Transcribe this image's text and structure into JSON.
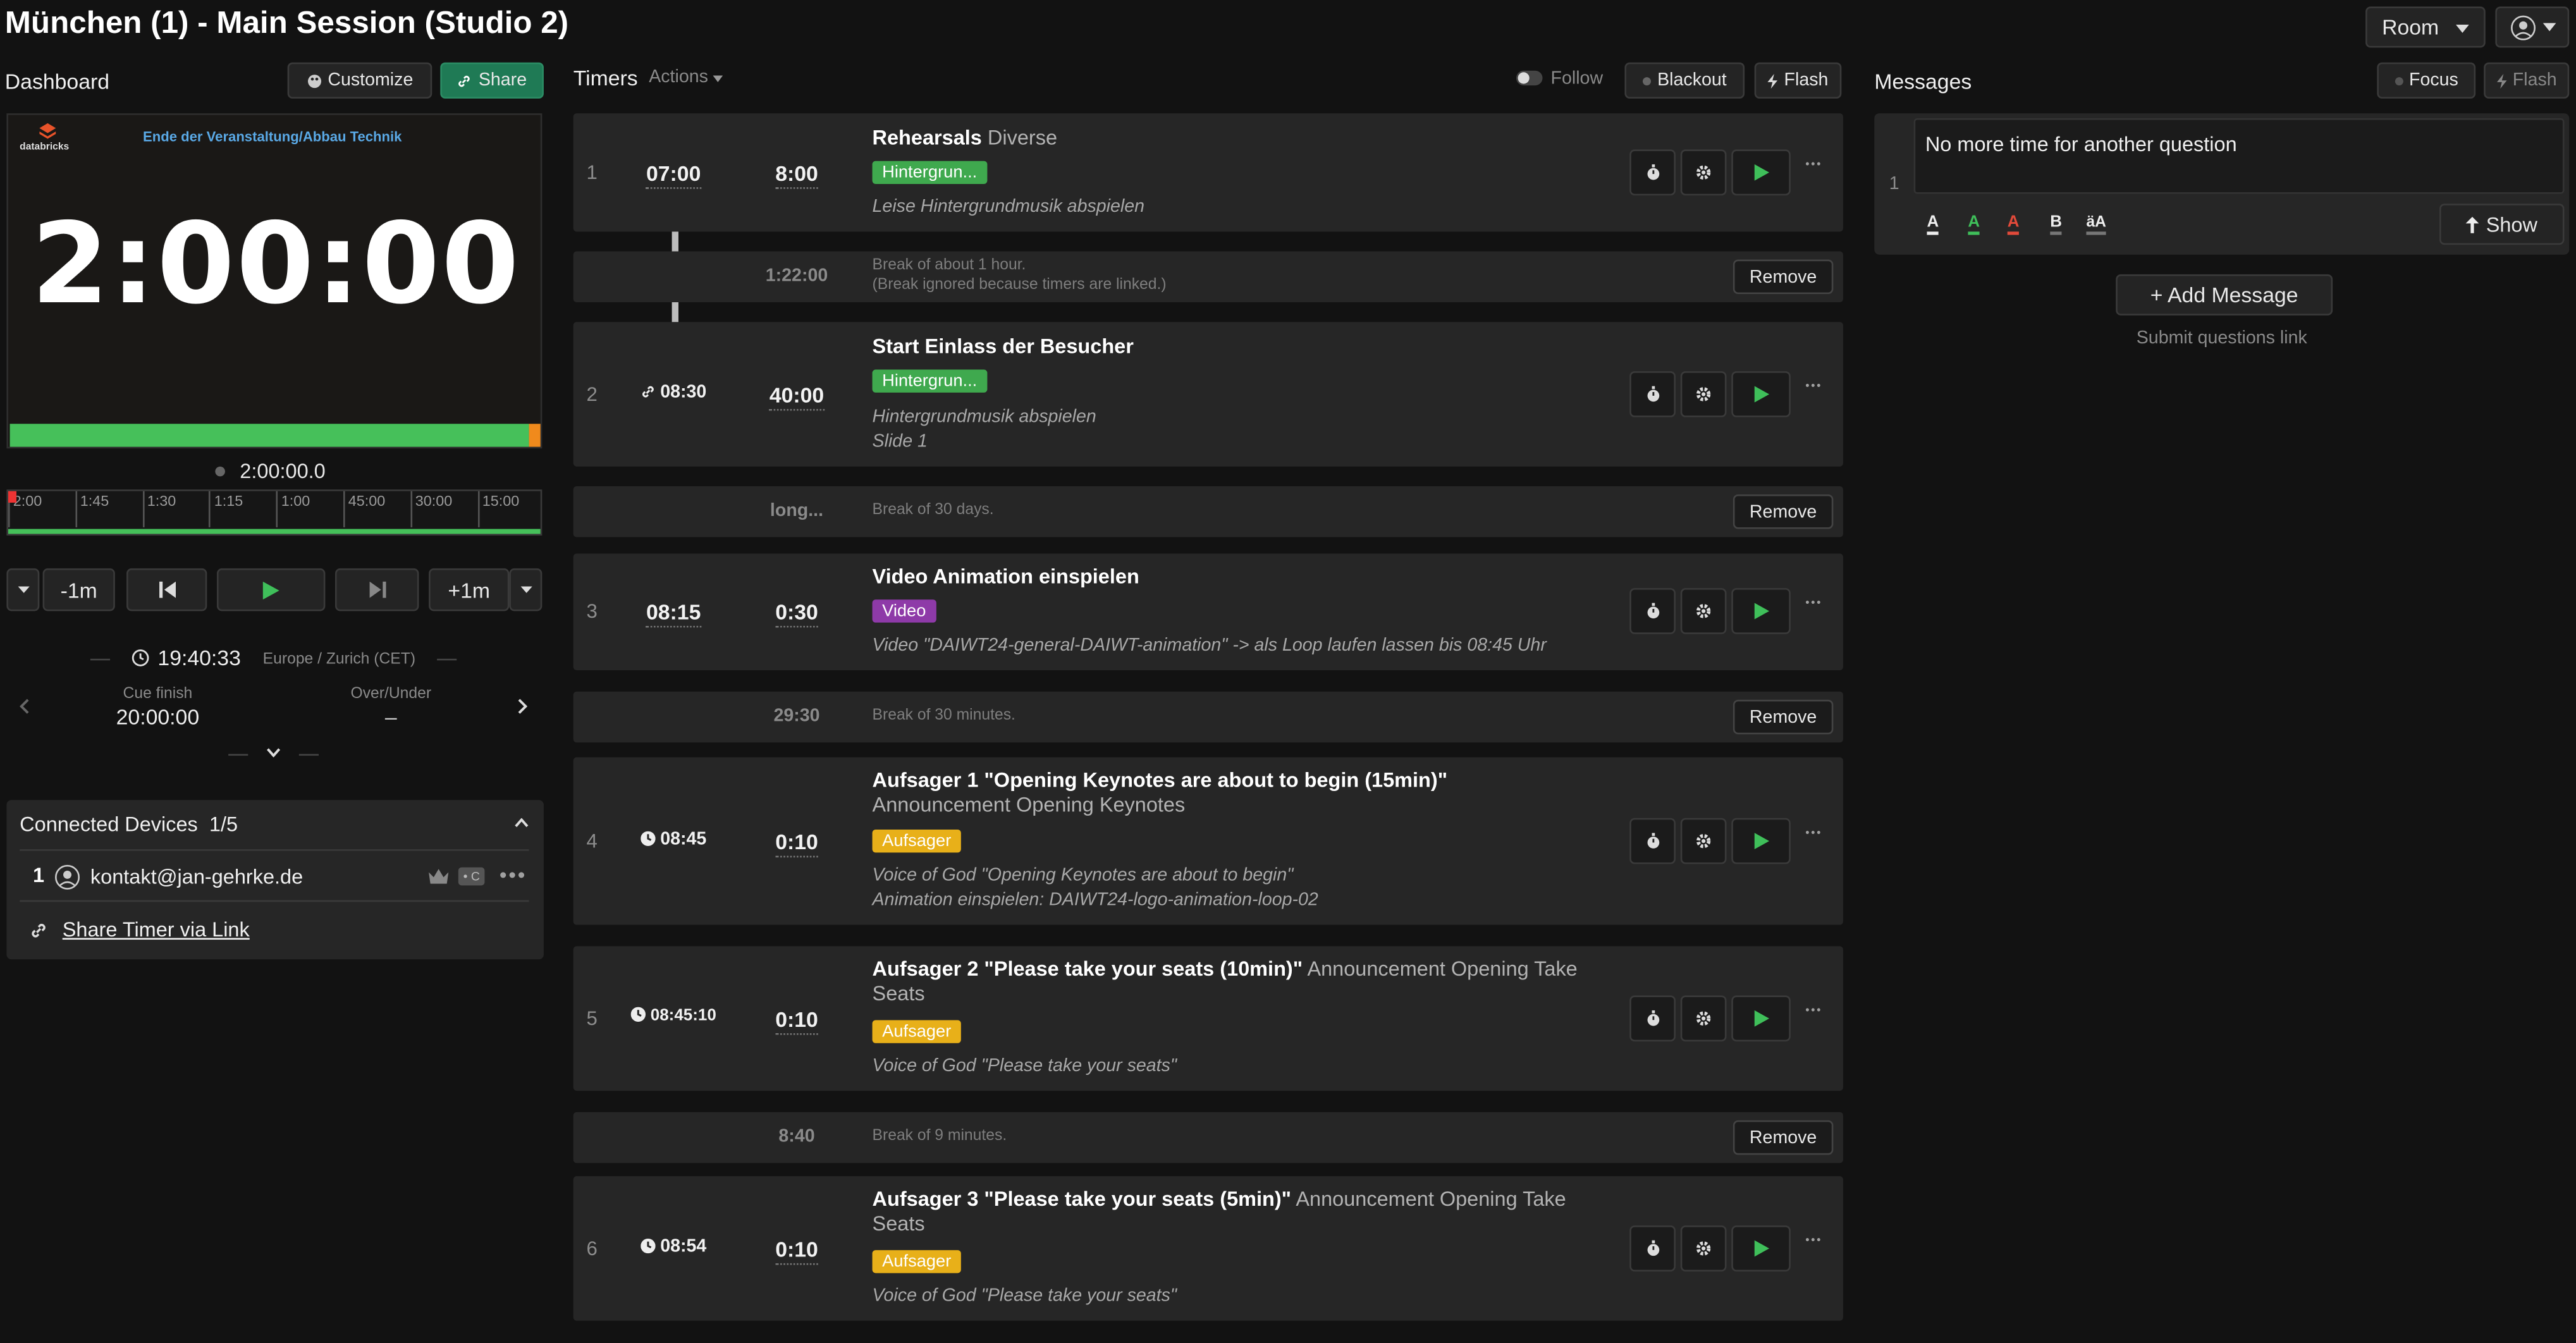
{
  "header": {
    "title": "München (1) - Main Session (Studio 2)",
    "room_label": "Room"
  },
  "dashboard": {
    "label": "Dashboard",
    "customize": "Customize",
    "share": "Share",
    "preview": {
      "logo_text": "databricks",
      "message": "Ende der Veranstaltung/Abbau Technik",
      "time": "2:00:00"
    },
    "elapsed": "2:00:00.0",
    "scale_ticks": [
      "2:00",
      "1:45",
      "1:30",
      "1:15",
      "1:00",
      "45:00",
      "30:00",
      "15:00"
    ],
    "controls": {
      "minus": "-1m",
      "plus": "+1m"
    },
    "clock": "19:40:33",
    "timezone": "Europe / Zurich (CET)",
    "cue_finish_label": "Cue finish",
    "cue_finish_value": "20:00:00",
    "over_under_label": "Over/Under",
    "over_under_value": "–",
    "progress": 0.97
  },
  "devices": {
    "title": "Connected Devices",
    "count": "1/5",
    "items": [
      {
        "num": "1",
        "email": "kontakt@jan-gehrke.de",
        "badge": "• C"
      }
    ],
    "share_link": "Share Timer via Link"
  },
  "timers": {
    "label": "Timers",
    "actions": "Actions",
    "follow": "Follow",
    "blackout": "Blackout",
    "flash": "Flash",
    "rows": [
      {
        "num": "1",
        "start": "07:00",
        "duration": "8:00",
        "title": "Rehearsals",
        "speaker": "Diverse",
        "tag": "Hintergrun...",
        "notes": [
          "Leise Hintergrundmusik abspielen"
        ]
      },
      {
        "num": "2",
        "start": "08:30",
        "duration": "40:00",
        "title": "Start Einlass der Besucher",
        "speaker": "",
        "tag": "Hintergrun...",
        "notes": [
          "Hintergrundmusik abspielen",
          "Slide 1"
        ]
      },
      {
        "num": "3",
        "start": "08:15",
        "duration": "0:30",
        "title": "Video Animation einspielen",
        "speaker": "",
        "tag": "Video",
        "notes": [
          "Video \"DAIWT24-general-DAIWT-animation\" -> als Loop laufen lassen bis 08:45 Uhr"
        ]
      },
      {
        "num": "4",
        "start": "08:45",
        "duration": "0:10",
        "title": "Aufsager 1 \"Opening Keynotes are about to begin (15min)\"",
        "speaker": "Announcement Opening Keynotes",
        "tag": "Aufsager",
        "notes": [
          "Voice of God \"Opening Keynotes are about to begin\"",
          "Animation einspielen: DAIWT24-logo-animation-loop-02"
        ]
      },
      {
        "num": "5",
        "start": "08:45:10",
        "duration": "0:10",
        "title": "Aufsager 2 \"Please take your seats (10min)\"",
        "speaker": "Announcement Opening Take Seats",
        "tag": "Aufsager",
        "notes": [
          "Voice of God \"Please take your seats\""
        ]
      },
      {
        "num": "6",
        "start": "08:54",
        "duration": "0:10",
        "title": "Aufsager 3 \"Please take your seats (5min)\"",
        "speaker": "Announcement Opening Take Seats",
        "tag": "Aufsager",
        "notes": [
          "Voice of God \"Please take your seats\""
        ]
      }
    ],
    "gaps": [
      {
        "duration": "1:22:00",
        "line1": "Break of about 1 hour.",
        "line2": "(Break ignored because timers are linked.)",
        "remove": "Remove"
      },
      {
        "duration": "long...",
        "line1": "Break of 30 days.",
        "line2": "",
        "remove": "Remove"
      },
      {
        "duration": "29:30",
        "line1": "Break of 30 minutes.",
        "line2": "",
        "remove": "Remove"
      },
      {
        "duration": "8:40",
        "line1": "Break of 9 minutes.",
        "line2": "",
        "remove": "Remove"
      }
    ]
  },
  "messages": {
    "label": "Messages",
    "focus": "Focus",
    "flash": "Flash",
    "item_num": "1",
    "item_text": "No more time for another question",
    "format": [
      "A",
      "A",
      "A",
      "B",
      "äA"
    ],
    "show": "Show",
    "add": "+ Add Message",
    "submit_link": "Submit questions link"
  },
  "colors": {
    "green": "#3fa94e",
    "purple": "#8e3aa8",
    "yellow": "#e8b019",
    "progress_green": "#46c05a",
    "progress_orange": "#f08a1c"
  }
}
